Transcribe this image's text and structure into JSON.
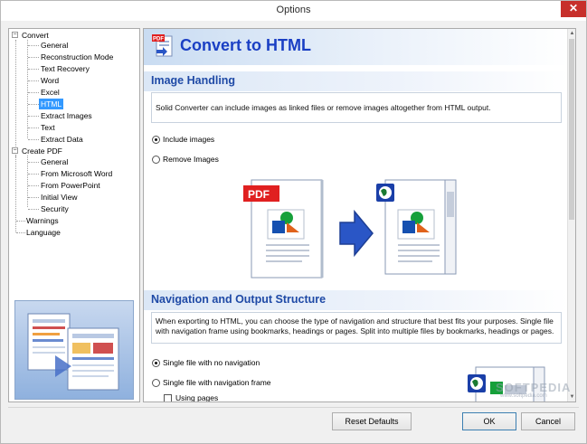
{
  "window": {
    "title": "Options",
    "close_symbol": "✕"
  },
  "tree": {
    "items": [
      {
        "label": "Convert",
        "level": 0,
        "expander": "−"
      },
      {
        "label": "General",
        "level": 1
      },
      {
        "label": "Reconstruction Mode",
        "level": 1
      },
      {
        "label": "Text Recovery",
        "level": 1
      },
      {
        "label": "Word",
        "level": 1
      },
      {
        "label": "Excel",
        "level": 1
      },
      {
        "label": "HTML",
        "level": 1,
        "selected": true
      },
      {
        "label": "Extract Images",
        "level": 1
      },
      {
        "label": "Text",
        "level": 1
      },
      {
        "label": "Extract Data",
        "level": 1
      },
      {
        "label": "Create PDF",
        "level": 0,
        "expander": "−"
      },
      {
        "label": "General",
        "level": 1
      },
      {
        "label": "From Microsoft Word",
        "level": 1
      },
      {
        "label": "From PowerPoint",
        "level": 1
      },
      {
        "label": "Initial View",
        "level": 1
      },
      {
        "label": "Security",
        "level": 1
      },
      {
        "label": "Warnings",
        "level": 0
      },
      {
        "label": "Language",
        "level": 0
      }
    ]
  },
  "content": {
    "page_title": "Convert to HTML",
    "image_handling": {
      "heading": "Image Handling",
      "description": "Solid Converter can include images as linked files or remove images altogether from HTML output.",
      "options": [
        {
          "label": "Include images",
          "checked": true
        },
        {
          "label": "Remove Images",
          "checked": false
        }
      ],
      "pdf_badge": "PDF"
    },
    "navigation": {
      "heading": "Navigation and Output Structure",
      "description": "When exporting to HTML, you can choose the type of navigation and structure that best fits your purposes. Single file with navigation frame using bookmarks, headings or pages. Split into multiple files by bookmarks, headings or pages.",
      "options": [
        {
          "label": "Single file with no navigation",
          "checked": true
        },
        {
          "label": "Single file with navigation frame",
          "checked": false
        }
      ],
      "checkbox_label": "Using pages"
    }
  },
  "buttons": {
    "reset": "Reset Defaults",
    "ok": "OK",
    "cancel": "Cancel"
  },
  "watermark": {
    "text": "SOFTPEDIA",
    "sub": "www.softpedia.com"
  },
  "colors": {
    "title_blue": "#1a3fc4",
    "section_blue": "#1f4aa6",
    "selection": "#3399ff",
    "pdf_red": "#e02020",
    "arrow_blue": "#2a56c6"
  }
}
